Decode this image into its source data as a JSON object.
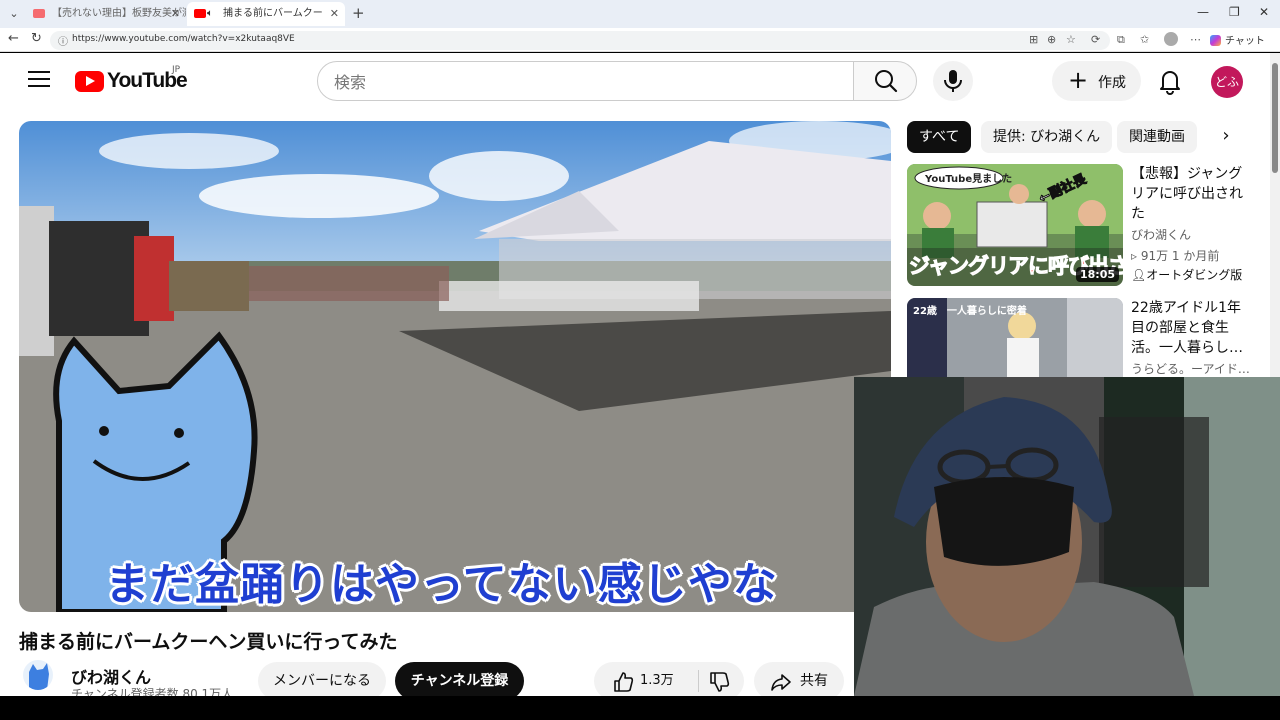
{
  "browser": {
    "tabs": [
      {
        "title": "【売れない理由】板野友美が激怒して",
        "active": false
      },
      {
        "title": "捕まる前にバームクーヘン買いに行",
        "active": true
      }
    ],
    "url": "https://www.youtube.com/watch?v=x2kutaaq8VE",
    "chat_label": "チャット"
  },
  "header": {
    "logo_text": "YouTube",
    "country_code": "JP",
    "search_placeholder": "検索",
    "create_label": "作成",
    "avatar_text": "どふ"
  },
  "video": {
    "subtitle": "まだ盆踊りはやってない感じやな",
    "title": "捕まる前にバームクーヘン買いに行ってみた",
    "channel_name": "びわ湖くん",
    "subscribers": "チャンネル登録者数 80.1万人",
    "member_label": "メンバーになる",
    "subscribe_label": "チャンネル登録",
    "like_count": "1.3万",
    "share_label": "共有"
  },
  "filters": {
    "chips": [
      "すべて",
      "提供: びわ湖くん",
      "関連動画"
    ]
  },
  "recommendations": [
    {
      "title": "【悲報】ジャングリアに呼び出された",
      "channel": "びわ湖くん",
      "meta": "91万  1 か月前",
      "badge": "オートダビング版",
      "duration": "18:05",
      "thumb_caption": "ジャングリアに呼び出された",
      "thumb_bubble": "YouTube見ました",
      "thumb_tag": "←副社長"
    },
    {
      "title": "22歳アイドル1年目の部屋と食生活。一人暮らし…",
      "channel": "うらどる。ーアイド…",
      "thumb_caption": "22歳　一人暮らしに密着"
    }
  ],
  "icons": {
    "menu": "menu-icon",
    "search": "search-icon",
    "mic": "mic-icon",
    "bell": "bell-icon",
    "like": "thumb-up-icon",
    "dislike": "thumb-down-icon",
    "share": "share-icon"
  },
  "colors": {
    "brand_red": "#ff0000",
    "subtitle_blue": "#1f3fd1",
    "avatar_bg": "#c2185b"
  }
}
